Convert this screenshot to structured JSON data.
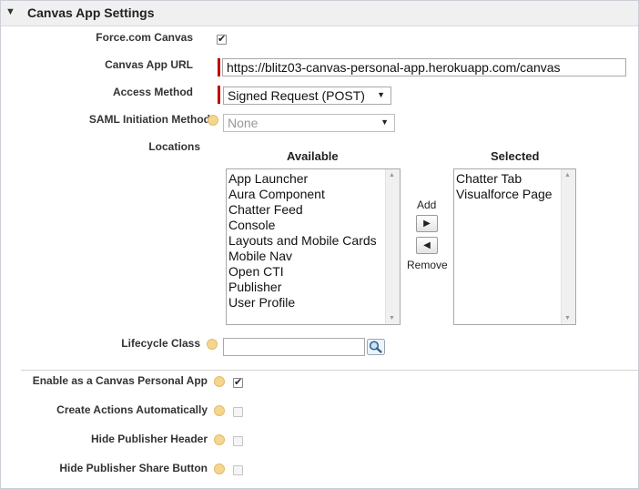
{
  "section": {
    "title": "Canvas App Settings",
    "toggle_icon": "triangle-down-icon"
  },
  "fields": {
    "force_canvas": {
      "label": "Force.com Canvas",
      "checked": true
    },
    "canvas_url": {
      "label": "Canvas App URL",
      "value": "https://blitz03-canvas-personal-app.herokuapp.com/canvas"
    },
    "access_method": {
      "label": "Access Method",
      "selected": "Signed Request (POST)"
    },
    "saml_initiation": {
      "label": "SAML Initiation Method",
      "selected": "None",
      "disabled": true
    },
    "locations": {
      "label": "Locations",
      "available_label": "Available",
      "selected_label": "Selected",
      "available": [
        "App Launcher",
        "Aura Component",
        "Chatter Feed",
        "Console",
        "Layouts and Mobile Cards",
        "Mobile Nav",
        "Open CTI",
        "Publisher",
        "User Profile"
      ],
      "selected": [
        "Chatter Tab",
        "Visualforce Page"
      ],
      "add_label": "Add",
      "remove_label": "Remove"
    },
    "lifecycle_class": {
      "label": "Lifecycle Class",
      "value": ""
    },
    "personal_app": {
      "label": "Enable as a Canvas Personal App",
      "checked": true
    },
    "create_actions": {
      "label": "Create Actions Automatically",
      "checked": false
    },
    "hide_publisher_header": {
      "label": "Hide Publisher Header",
      "checked": false
    },
    "hide_publisher_share": {
      "label": "Hide Publisher Share Button",
      "checked": false
    }
  },
  "colors": {
    "required": "#c00000",
    "help_icon": "#f4d692",
    "header_bg": "#f0f0f0"
  }
}
